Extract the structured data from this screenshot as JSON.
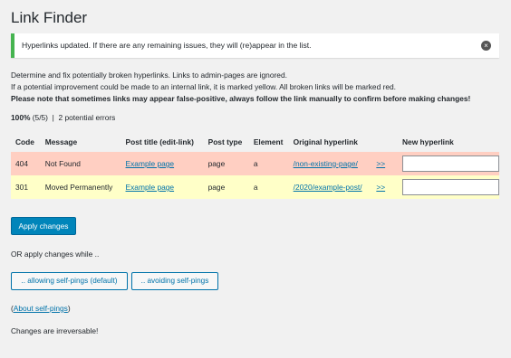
{
  "page": {
    "title": "Link Finder"
  },
  "notice": {
    "text": "Hyperlinks updated. If there are any remaining issues, they will (re)appear in the list.",
    "dismiss": "×"
  },
  "description": {
    "line1": "Determine and fix potentially broken hyperlinks. Links to admin-pages are ignored.",
    "line2": "If a potential improvement could be made to an internal link, it is marked yellow. All broken links will be marked red.",
    "line3": "Please note that sometimes links may appear false-positive, always follow the link manually to confirm before making changes!"
  },
  "summary": {
    "progress": "100%",
    "count": "(5/5)",
    "separator": "|",
    "errors": "2 potential errors"
  },
  "table": {
    "headers": {
      "code": "Code",
      "message": "Message",
      "post_title": "Post title (edit-link)",
      "post_type": "Post type",
      "element": "Element",
      "original": "Original hyperlink",
      "follow": "",
      "new": "New hyperlink"
    },
    "rows": [
      {
        "code": "404",
        "message": "Not Found",
        "post_title": "Example page",
        "post_type": "page",
        "element": "a",
        "original": "/non-existing-page/",
        "follow": ">>",
        "new_value": "",
        "status": "red"
      },
      {
        "code": "301",
        "message": "Moved Permanently",
        "post_title": "Example page",
        "post_type": "page",
        "element": "a",
        "original": "/2020/example-post/",
        "follow": ">>",
        "new_value": "",
        "status": "yellow"
      }
    ]
  },
  "actions": {
    "apply": "Apply changes",
    "or_text": "OR apply changes while ..",
    "allow_pings": ".. allowing self-pings (default)",
    "avoid_pings": ".. avoiding self-pings",
    "about_open": "(",
    "about_link": "About self-pings",
    "about_close": ")",
    "irreversible": "Changes are irreversable!"
  },
  "colors": {
    "red_row": "#ffcfc2",
    "yellow_row": "#ffffc8",
    "notice_border": "#46b450",
    "primary": "#0085ba",
    "link": "#0073aa"
  }
}
